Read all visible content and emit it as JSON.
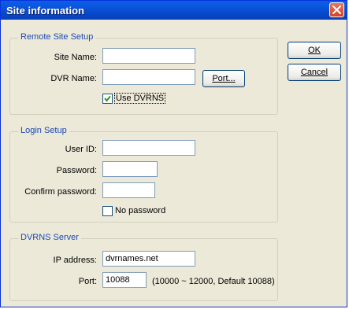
{
  "window": {
    "title": "Site information"
  },
  "remote_site": {
    "section_label": "Remote Site Setup",
    "site_name_label": "Site Name:",
    "site_name_value": "",
    "dvr_name_label": "DVR Name:",
    "dvr_name_value": "",
    "port_button": "Port...",
    "use_dvrns_label": "Use DVRNS",
    "use_dvrns_checked": true
  },
  "login": {
    "section_label": "Login Setup",
    "user_id_label": "User ID:",
    "user_id_value": "",
    "password_label": "Password:",
    "password_value": "",
    "confirm_label": "Confirm password:",
    "confirm_value": "",
    "no_password_label": "No password",
    "no_password_checked": false
  },
  "dvrns": {
    "section_label": "DVRNS Server",
    "ip_label": "IP address:",
    "ip_value": "dvrnames.net",
    "port_label": "Port:",
    "port_value": "10088",
    "port_hint": "(10000 ~ 12000, Default 10088)"
  },
  "buttons": {
    "ok": "OK",
    "cancel": "Cancel"
  },
  "colors": {
    "title_bar": "#0a53d9",
    "close_button": "#d2432a",
    "section_label": "#1a4ab5",
    "dialog_bg": "#ece9d8"
  },
  "icons": {
    "close": "close-icon",
    "check": "checkmark-icon"
  }
}
